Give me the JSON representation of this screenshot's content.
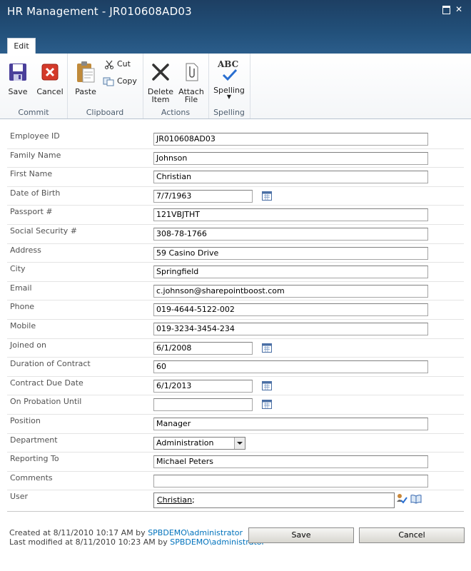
{
  "window": {
    "title": "HR Management - JR010608AD03"
  },
  "ribbon": {
    "tab": "Edit",
    "groups": {
      "commit": "Commit",
      "clipboard": "Clipboard",
      "actions": "Actions",
      "spelling": "Spelling"
    },
    "buttons": {
      "save": "Save",
      "cancel": "Cancel",
      "paste": "Paste",
      "cut": "Cut",
      "copy": "Copy",
      "delete_l1": "Delete",
      "delete_l2": "Item",
      "attach_l1": "Attach",
      "attach_l2": "File",
      "spelling": "Spelling",
      "spelling_abc": "ABC"
    }
  },
  "form": {
    "fields": [
      {
        "label": "Employee ID",
        "value": "JR010608AD03"
      },
      {
        "label": "Family Name",
        "value": "Johnson"
      },
      {
        "label": "First Name",
        "value": "Christian"
      },
      {
        "label": "Date of Birth",
        "value": "7/7/1963"
      },
      {
        "label": "Passport #",
        "value": "121VBJTHT"
      },
      {
        "label": "Social Security #",
        "value": "308-78-1766"
      },
      {
        "label": "Address",
        "value": "59 Casino Drive"
      },
      {
        "label": "City",
        "value": "Springfield"
      },
      {
        "label": "Email",
        "value": "c.johnson@sharepointboost.com"
      },
      {
        "label": "Phone",
        "value": "019-4644-5122-002"
      },
      {
        "label": "Mobile",
        "value": "019-3234-3454-234"
      },
      {
        "label": "Joined on",
        "value": "6/1/2008"
      },
      {
        "label": "Duration of Contract",
        "value": "60"
      },
      {
        "label": "Contract Due Date",
        "value": "6/1/2013"
      },
      {
        "label": "On Probation Until",
        "value": ""
      },
      {
        "label": "Position",
        "value": "Manager"
      },
      {
        "label": "Department",
        "value": "Administration"
      },
      {
        "label": "Reporting To",
        "value": "Michael Peters"
      },
      {
        "label": "Comments",
        "value": ""
      },
      {
        "label": "User",
        "value": "Christian",
        "suffix": ";"
      }
    ]
  },
  "footer": {
    "created_prefix": "Created at 8/11/2010 10:17 AM by ",
    "created_by": "SPBDEMO\\administrator",
    "modified_prefix": "Last modified at 8/11/2010 10:23 AM by ",
    "modified_by": "SPBDEMO\\administrator",
    "save_label": "Save",
    "cancel_label": "Cancel"
  },
  "colors": {
    "titlebar": "#22507a",
    "link": "#0072bc"
  }
}
